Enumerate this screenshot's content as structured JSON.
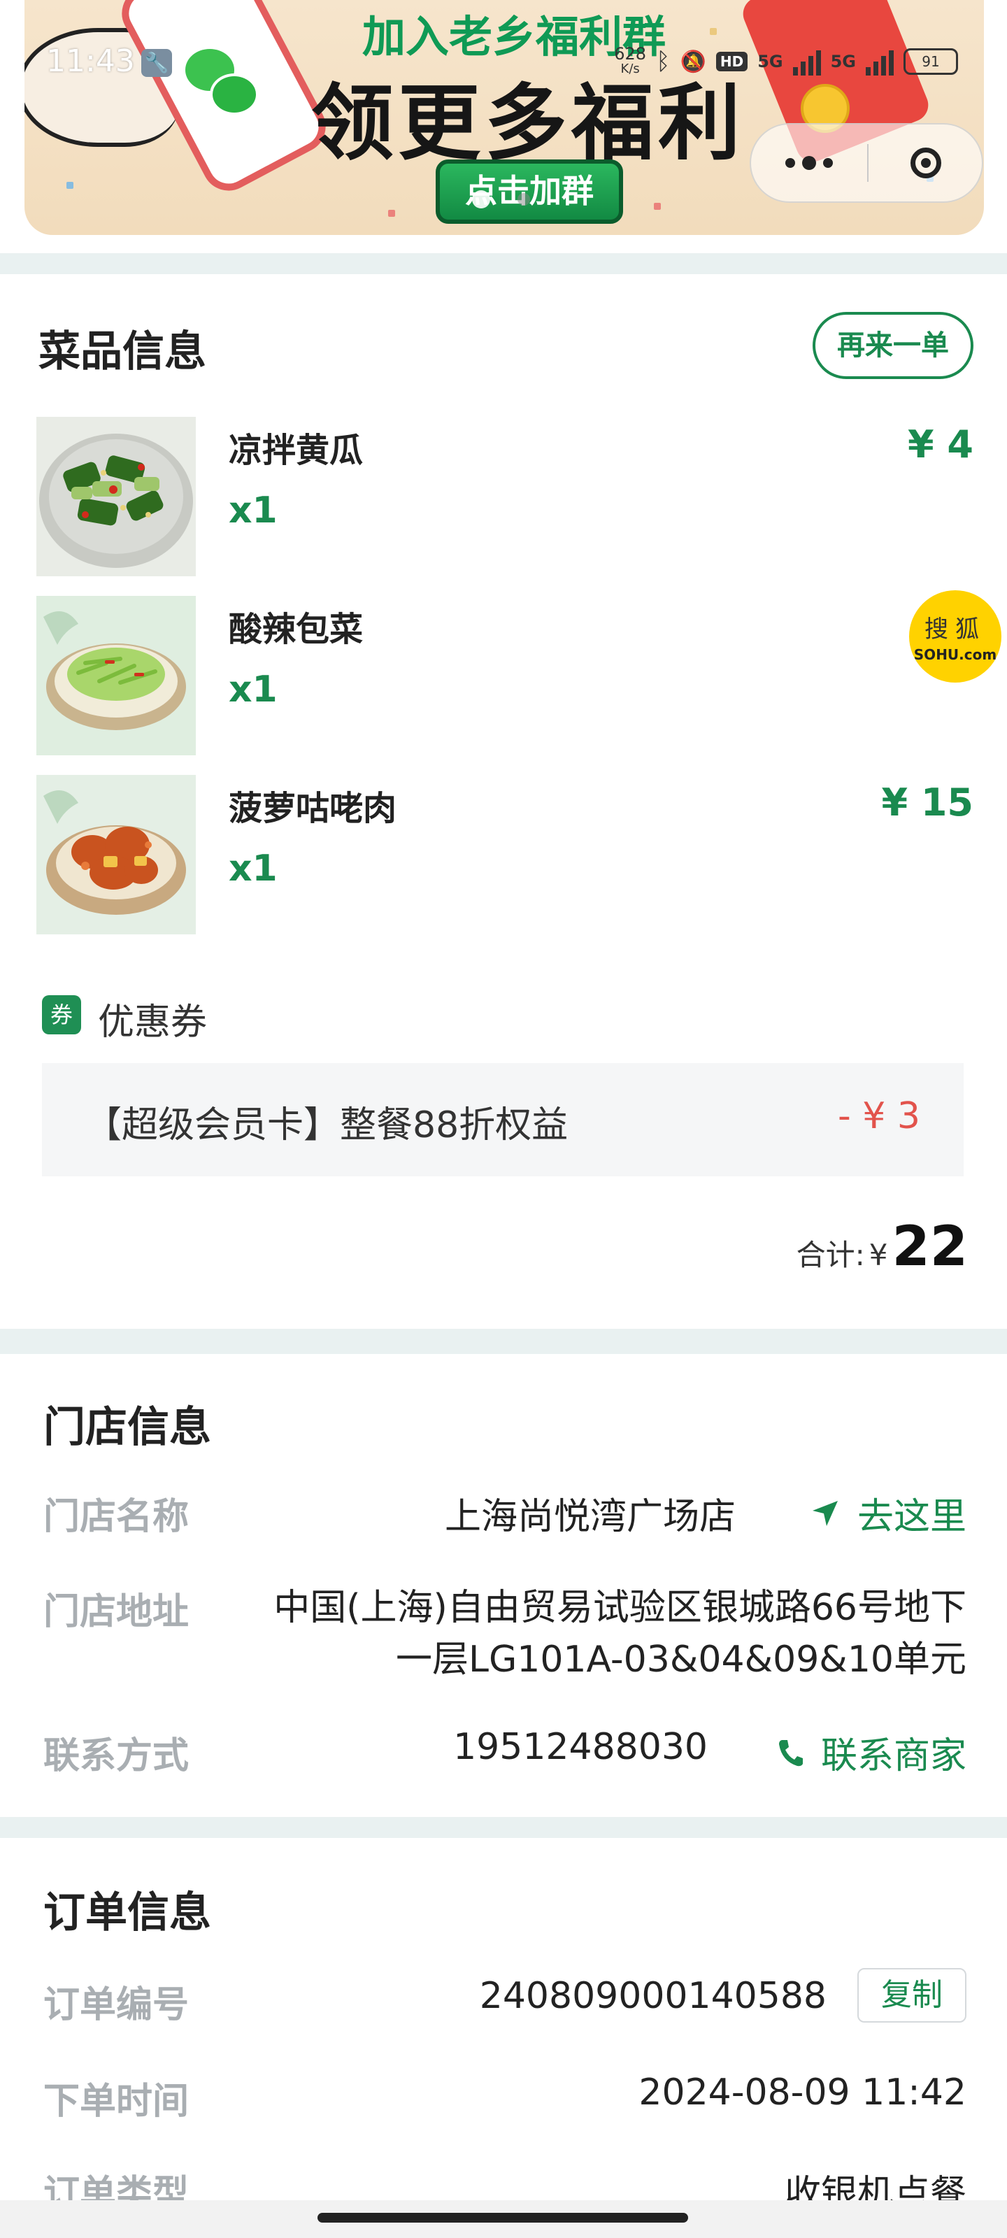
{
  "status_bar": {
    "time": "11:43",
    "speed_value": "628",
    "speed_unit": "K/s",
    "hd_label": "HD",
    "network_1": "5G",
    "network_2": "5G",
    "battery": "91"
  },
  "banner": {
    "title_top": "加入老乡福利群",
    "title_main": "领更多福利",
    "cta_label": "点击加群"
  },
  "dishes_section": {
    "title": "菜品信息",
    "reorder_label": "再来一单",
    "items": [
      {
        "name": "凉拌黄瓜",
        "qty": "x1",
        "price": "¥ 4"
      },
      {
        "name": "酸辣包菜",
        "qty": "x1",
        "price": ""
      },
      {
        "name": "菠萝咕咾肉",
        "qty": "x1",
        "price": "¥ 15"
      }
    ],
    "coupon_tag": "券",
    "coupon_label": "优惠券",
    "coupon_desc": "【超级会员卡】整餐88折权益",
    "coupon_amount": "- ¥ 3",
    "total_label": "合计:",
    "total_currency": "¥",
    "total_value": "22"
  },
  "store_section": {
    "title": "门店信息",
    "name_label": "门店名称",
    "name_value": "上海尚悦湾广场店",
    "navigate_label": "去这里",
    "address_label": "门店地址",
    "address_value": "中国(上海)自由贸易试验区银城路66号地下一层LG101A-03&04&09&10单元",
    "contact_label": "联系方式",
    "contact_value": "19512488030",
    "call_label": "联系商家"
  },
  "order_section": {
    "title": "订单信息",
    "number_label": "订单编号",
    "number_value": "240809000140588",
    "copy_label": "复制",
    "time_label": "下单时间",
    "time_value": "2024-08-09 11:42",
    "type_label": "订单类型",
    "type_value": "收银机点餐"
  },
  "sohu": {
    "cn": "搜狐",
    "en": "SOHU.com"
  },
  "colors": {
    "brand_green": "#1a8a4f",
    "discount_red": "#e2534c",
    "page_bg": "#e9f1f1"
  },
  "icons": [
    "wrench-icon",
    "wechat-icon",
    "more-dots-icon",
    "close-target-icon",
    "navigate-arrow-icon",
    "phone-icon",
    "coupon-icon"
  ]
}
